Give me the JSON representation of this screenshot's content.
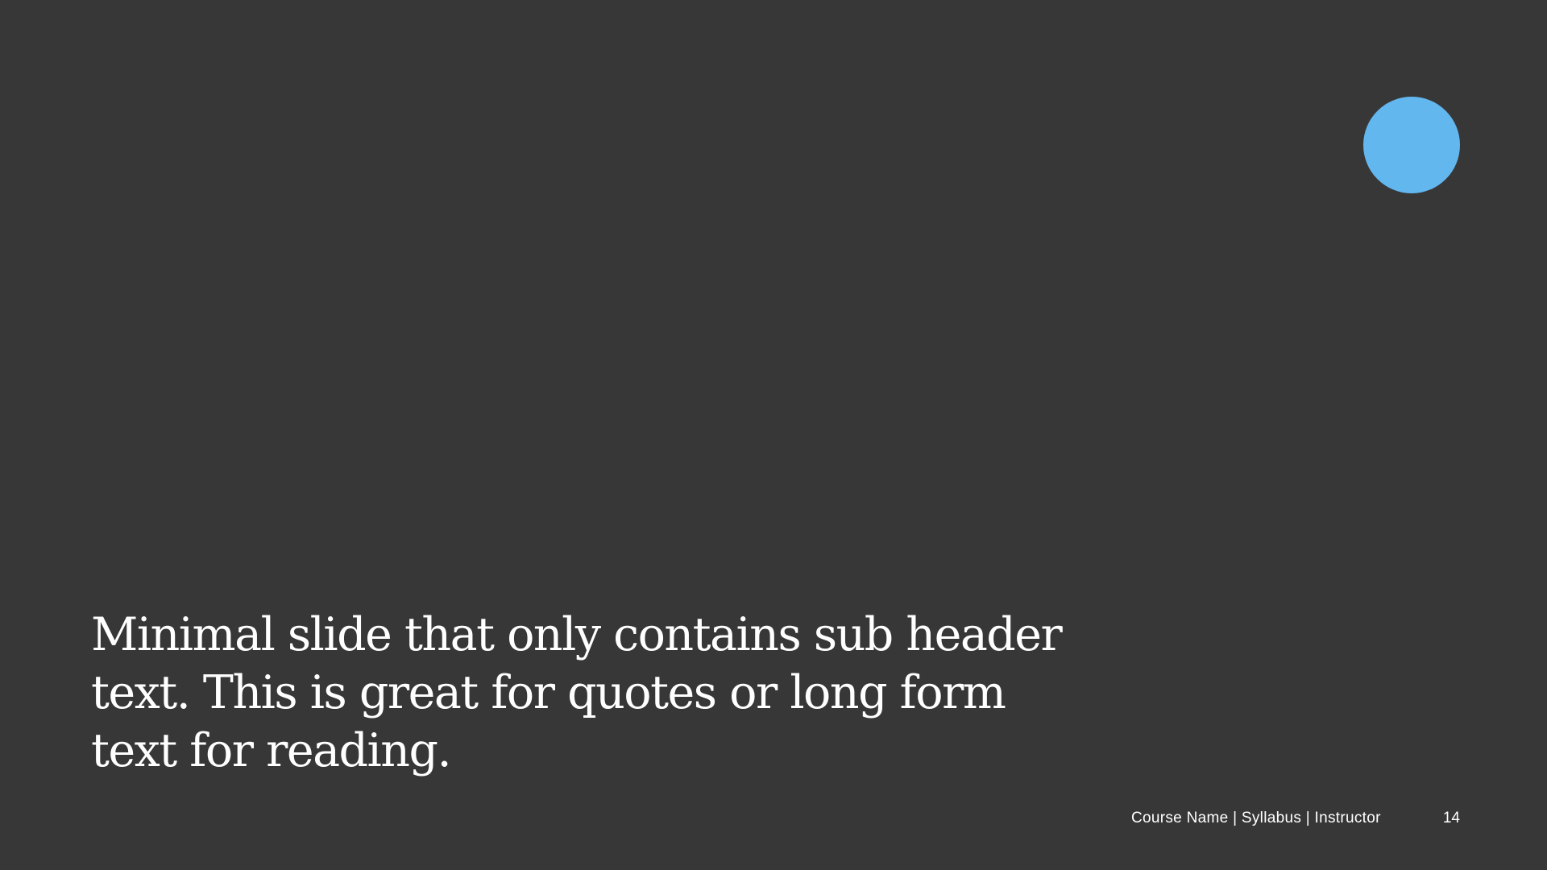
{
  "slide": {
    "body_text": "Minimal slide that only contains sub header text. This is great for quotes or long form text for reading.",
    "footer": "Course Name | Syllabus | Instructor",
    "page_number": "14",
    "accent_color": "#62b7ef",
    "background_color": "#373737"
  }
}
